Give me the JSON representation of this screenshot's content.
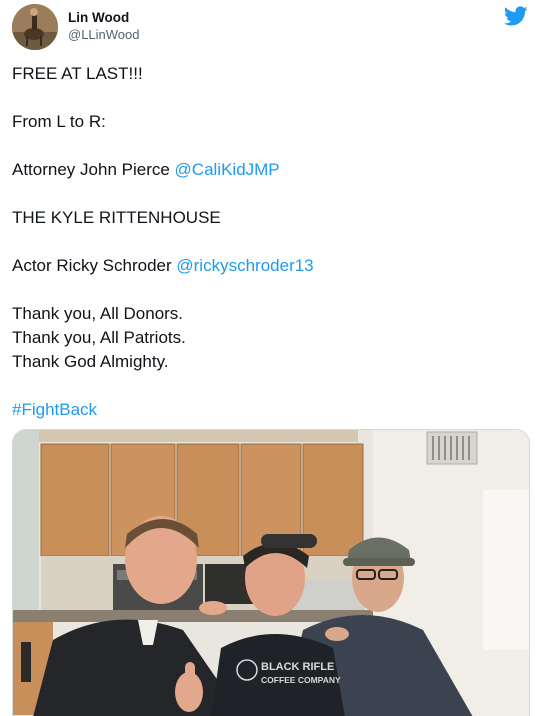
{
  "author": {
    "display_name": "Lin Wood",
    "handle": "@LLinWood"
  },
  "icons": {
    "avatar": "profile-photo",
    "platform": "twitter-bird-icon"
  },
  "tweet": {
    "line1": "FREE AT LAST!!!",
    "line2": "From L to R:",
    "line3_text": "Attorney John Pierce ",
    "line3_mention": "@CaliKidJMP",
    "line4": "THE KYLE RITTENHOUSE",
    "line5_text": "Actor Ricky Schroder ",
    "line5_mention": "@rickyschroder13",
    "line6": "Thank you, All Donors.",
    "line7": "Thank you, All Patriots.",
    "line8": "Thank God Almighty.",
    "hashtag": "#FightBack"
  },
  "photo": {
    "shirt_line1": "BLACK RIFLE",
    "shirt_line2": "COFFEE COMPANY"
  },
  "colors": {
    "link": "#1d9bf0",
    "twitter_blue": "#1d9bf0",
    "text": "#0f1419",
    "secondary": "#536471"
  }
}
